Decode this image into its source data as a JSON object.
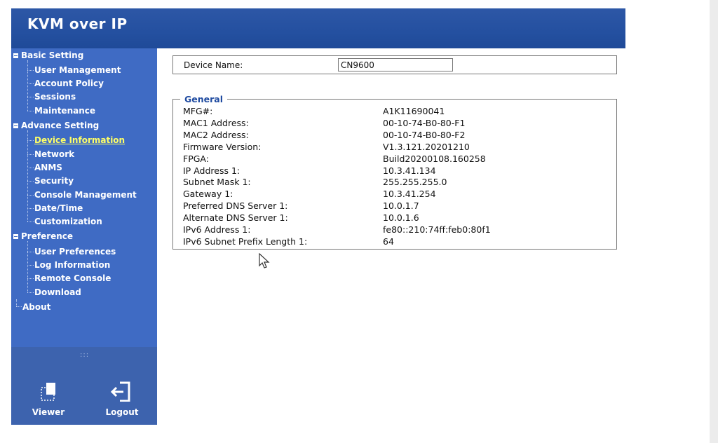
{
  "app": {
    "title": "KVM over IP"
  },
  "sidebar": {
    "groups": [
      {
        "label": "Basic Setting",
        "items": [
          "User Management",
          "Account Policy",
          "Sessions",
          "Maintenance"
        ]
      },
      {
        "label": "Advance Setting",
        "items": [
          "Device Information",
          "Network",
          "ANMS",
          "Security",
          "Console Management",
          "Date/Time",
          "Customization"
        ]
      },
      {
        "label": "Preference",
        "items": [
          "User Preferences",
          "Log Information",
          "Remote Console",
          "Download"
        ]
      }
    ],
    "about_label": "About",
    "active_item": "Device Information",
    "grip": ":::",
    "viewer_label": "Viewer",
    "logout_label": "Logout"
  },
  "device": {
    "name_label": "Device Name:",
    "name_value": "CN9600"
  },
  "general": {
    "legend": "General",
    "rows": [
      {
        "label": "MFG#:",
        "value": "A1K11690041"
      },
      {
        "label": "MAC1 Address:",
        "value": "00-10-74-B0-80-F1"
      },
      {
        "label": "MAC2 Address:",
        "value": "00-10-74-B0-80-F2"
      },
      {
        "label": "Firmware Version:",
        "value": "V1.3.121.20201210"
      },
      {
        "label": "FPGA:",
        "value": "Build20200108.160258"
      },
      {
        "label": "IP Address 1:",
        "value": "10.3.41.134"
      },
      {
        "label": "Subnet Mask 1:",
        "value": "255.255.255.0"
      },
      {
        "label": "Gateway 1:",
        "value": "10.3.41.254"
      },
      {
        "label": "Preferred DNS Server 1:",
        "value": "10.0.1.7"
      },
      {
        "label": "Alternate DNS Server 1:",
        "value": "10.0.1.6"
      },
      {
        "label": "IPv6 Address 1:",
        "value": "fe80::210:74ff:feb0:80f1"
      },
      {
        "label": "IPv6 Subnet Prefix Length 1:",
        "value": "64"
      }
    ]
  },
  "colors": {
    "header": "#2450a0",
    "sidebar": "#3f6bc4",
    "sidebar_bottom": "#3d63ae",
    "active_link": "#ffff66",
    "legend": "#1e4aa0"
  }
}
